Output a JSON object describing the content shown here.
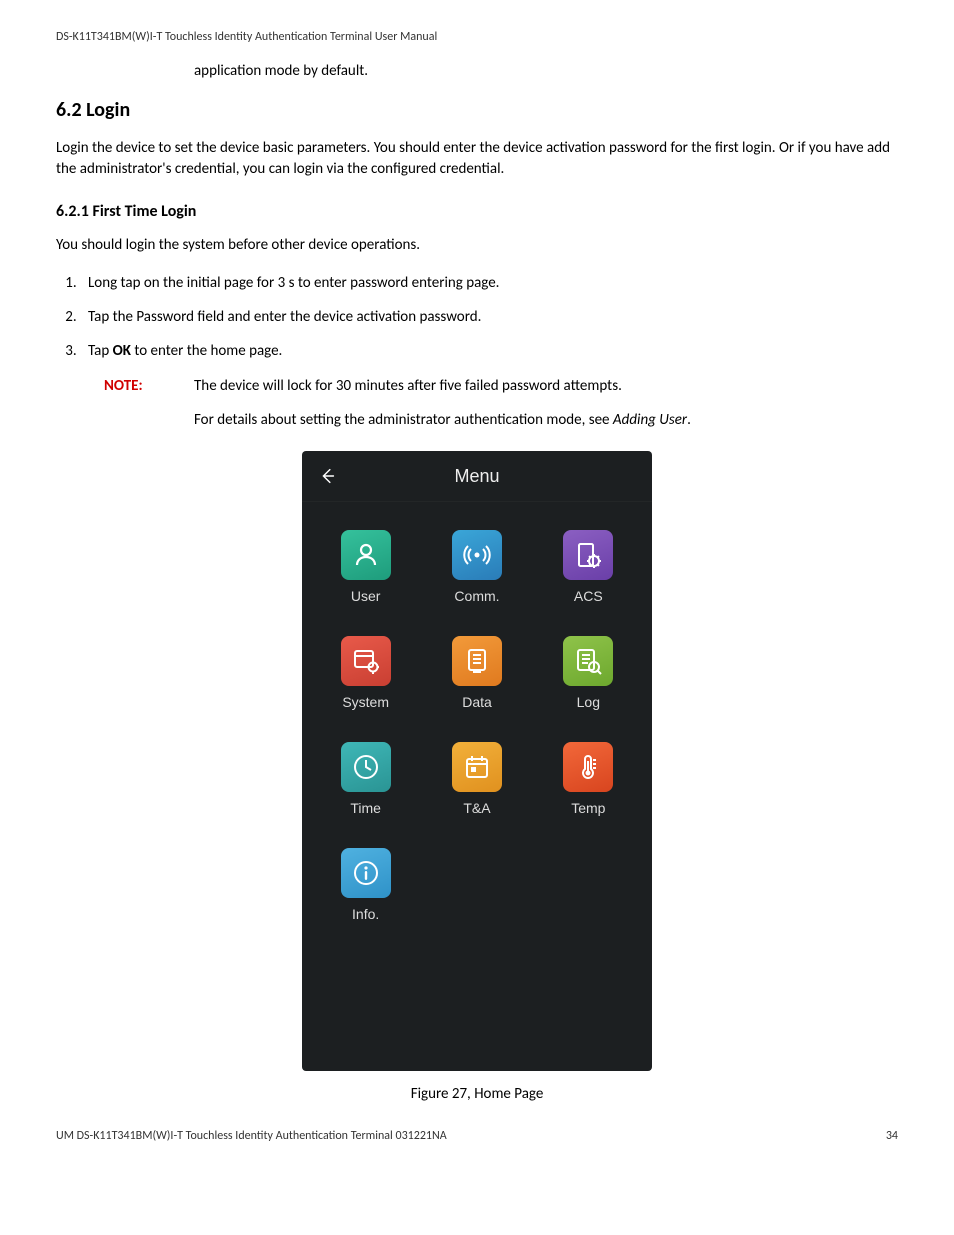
{
  "header": "DS-K11T341BM(W)I-T Touchless Identity Authentication Terminal User Manual",
  "prior_paragraph": "application mode by default.",
  "section": {
    "number": "6.2",
    "title": "Login"
  },
  "intro": "Login the device to set the device basic parameters. You should enter the device activation password for the first login. Or if you have add the administrator's credential, you can login via the configured credential.",
  "subsection": {
    "number": "6.2.1",
    "title": "First Time Login"
  },
  "sub_intro": "You should login the system before other device operations.",
  "steps": [
    "Long tap on the initial page for 3 s to enter password entering page.",
    "Tap the Password field and enter the device activation password.",
    {
      "prefix": "Tap ",
      "bold": "OK",
      "suffix": " to enter the home page."
    }
  ],
  "note_label": "NOTE:",
  "note_body": "The device will lock for 30 minutes after five failed password attempts.",
  "note_followup": {
    "prefix": "For details about setting the administrator authentication mode, see ",
    "ital": "Adding User",
    "suffix": "."
  },
  "screen": {
    "title": "Menu",
    "items": [
      {
        "label": "User",
        "icon": "user-icon",
        "grad": "grad-green"
      },
      {
        "label": "Comm.",
        "icon": "signal-icon",
        "grad": "grad-blue"
      },
      {
        "label": "ACS",
        "icon": "door-gear-icon",
        "grad": "grad-purple"
      },
      {
        "label": "System",
        "icon": "window-gear-icon",
        "grad": "grad-red"
      },
      {
        "label": "Data",
        "icon": "data-icon",
        "grad": "grad-orange"
      },
      {
        "label": "Log",
        "icon": "log-icon",
        "grad": "grad-lime"
      },
      {
        "label": "Time",
        "icon": "clock-icon",
        "grad": "grad-teal"
      },
      {
        "label": "T&A",
        "icon": "calendar-icon",
        "grad": "grad-amber"
      },
      {
        "label": "Temp",
        "icon": "thermometer-icon",
        "grad": "grad-hot"
      },
      {
        "label": "Info.",
        "icon": "info-icon",
        "grad": "grad-sky"
      }
    ]
  },
  "figure_caption": "Figure 27, Home Page",
  "footer_left": "UM DS-K11T341BM(W)I-T Touchless Identity Authentication Terminal 031221NA",
  "footer_right": "34"
}
